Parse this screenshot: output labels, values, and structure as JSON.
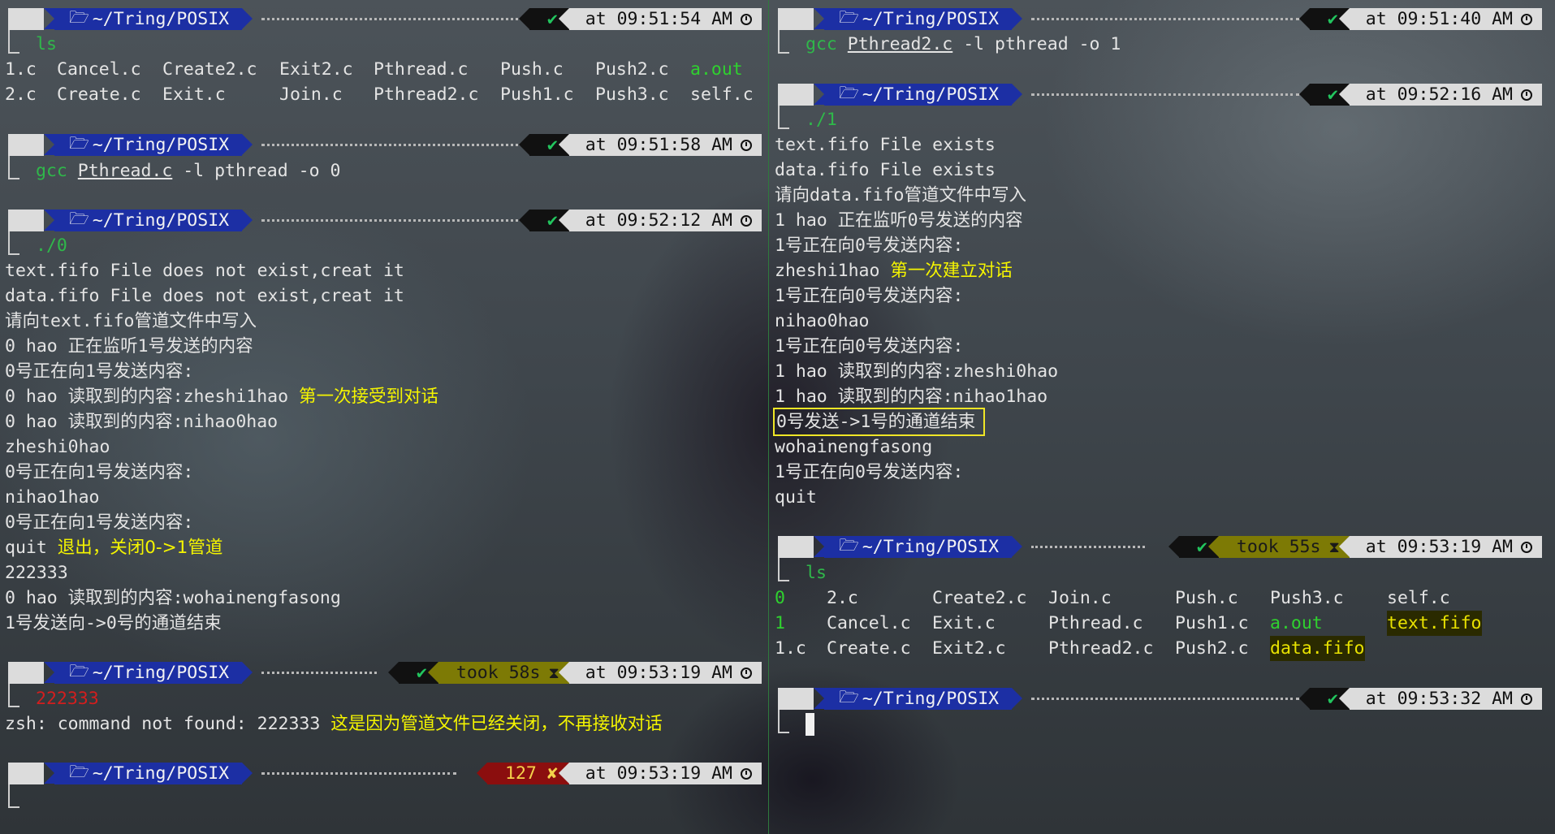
{
  "colors": {
    "dir_segment": "#1c2fa4",
    "status_ok": "#22c55e",
    "error_segment": "#8b0e0e",
    "took_segment": "#7d7a05",
    "time_segment": "#dcdcdc",
    "annotation": "#f5f500",
    "command_ok": "#2fb84a",
    "command_bad": "#d21e1e"
  },
  "icons": {
    "folder": "folder-open-icon",
    "check": "checkmark-icon",
    "cross": "cross-icon",
    "clock": "clock-icon",
    "hourglass": "hourglass-icon"
  },
  "left": {
    "p1": {
      "path": "~/Tring/POSIX",
      "status": "✔",
      "time": "at 09:51:54 AM",
      "cmd": "ls"
    },
    "ls1": {
      "row1": [
        "1.c",
        "Cancel.c",
        "Create2.c",
        "Exit2.c",
        "Pthread.c",
        "Push.c",
        "Push2.c",
        "a.out"
      ],
      "row2": [
        "2.c",
        "Create.c",
        "Exit.c",
        "Join.c",
        "Pthread2.c",
        "Push1.c",
        "Push3.c",
        "self.c"
      ]
    },
    "p2": {
      "path": "~/Tring/POSIX",
      "status": "✔",
      "time": "at 09:51:58 AM",
      "cmd": "gcc",
      "file": "Pthread.c",
      "args": " -l pthread -o 0"
    },
    "p3": {
      "path": "~/Tring/POSIX",
      "status": "✔",
      "time": "at 09:52:12 AM",
      "cmd": "./0"
    },
    "out": [
      "text.fifo File does not exist,creat it",
      "data.fifo File does not exist,creat it",
      "请向text.fifo管道文件中写入",
      "0 hao 正在监听1号发送的内容",
      "0号正在向1号发送内容:",
      "0 hao 读取到的内容:zheshi1hao ",
      "0 hao 读取到的内容:nihao0hao",
      "zheshi0hao",
      "0号正在向1号发送内容:",
      "nihao1hao",
      "0号正在向1号发送内容:",
      "quit ",
      "222333",
      "0 hao 读取到的内容:wohainengfasong",
      "1号发送向->0号的通道结束"
    ],
    "note1": "第一次接受到对话",
    "note2": "退出，关闭0->1管道",
    "p4": {
      "path": "~/Tring/POSIX",
      "status": "✔",
      "took": "took 58s",
      "time": "at 09:53:19 AM",
      "cmd": "222333"
    },
    "err_line": "zsh: command not found: 222333 ",
    "note3": "这是因为管道文件已经关闭，不再接收对话",
    "p5": {
      "path": "~/Tring/POSIX",
      "status": "127 ✘",
      "time": "at 09:53:19 AM"
    }
  },
  "right": {
    "p1": {
      "path": "~/Tring/POSIX",
      "status": "✔",
      "time": "at 09:51:40 AM",
      "cmd": "gcc",
      "file": "Pthread2.c",
      "args": " -l pthread -o 1"
    },
    "p2": {
      "path": "~/Tring/POSIX",
      "status": "✔",
      "time": "at 09:52:16 AM",
      "cmd": "./1"
    },
    "out": [
      "text.fifo File exists",
      "data.fifo File exists",
      "请向data.fifo管道文件中写入",
      "1 hao 正在监听0号发送的内容",
      "1号正在向0号发送内容:",
      "zheshi1hao ",
      "1号正在向0号发送内容:",
      "nihao0hao",
      "1号正在向0号发送内容:",
      "1 hao 读取到的内容:zheshi0hao",
      "1 hao 读取到的内容:nihao1hao",
      "0号发送->1号的通道结束",
      "wohainengfasong",
      "1号正在向0号发送内容:",
      "quit"
    ],
    "note1": "第一次建立对话",
    "p3": {
      "path": "~/Tring/POSIX",
      "status": "✔",
      "took": "took 55s",
      "time": "at 09:53:19 AM",
      "cmd": "ls"
    },
    "ls2": {
      "row1": [
        "0",
        "2.c",
        "Create2.c",
        "Join.c",
        "Push.c",
        "Push3.c",
        "self.c"
      ],
      "row2": [
        "1",
        "Cancel.c",
        "Exit.c",
        "Pthread.c",
        "Push1.c",
        "a.out",
        "text.fifo"
      ],
      "row3": [
        "1.c",
        "Create.c",
        "Exit2.c",
        "Pthread2.c",
        "Push2.c",
        "data.fifo"
      ]
    },
    "p4": {
      "path": "~/Tring/POSIX",
      "status": "✔",
      "time": "at 09:53:32 AM"
    }
  }
}
